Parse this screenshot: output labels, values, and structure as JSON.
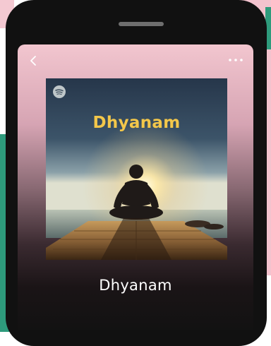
{
  "cover": {
    "title": "Dhyanam",
    "brand_icon": "spotify-icon"
  },
  "playlist": {
    "title": "Dhyanam"
  },
  "toolbar": {
    "back_icon": "chevron-left-icon",
    "more_icon": "more-horizontal-icon"
  },
  "colors": {
    "cover_title": "#f3c74a",
    "accent_green": "#2e9b7c",
    "accent_pink": "#f3c3ce"
  }
}
